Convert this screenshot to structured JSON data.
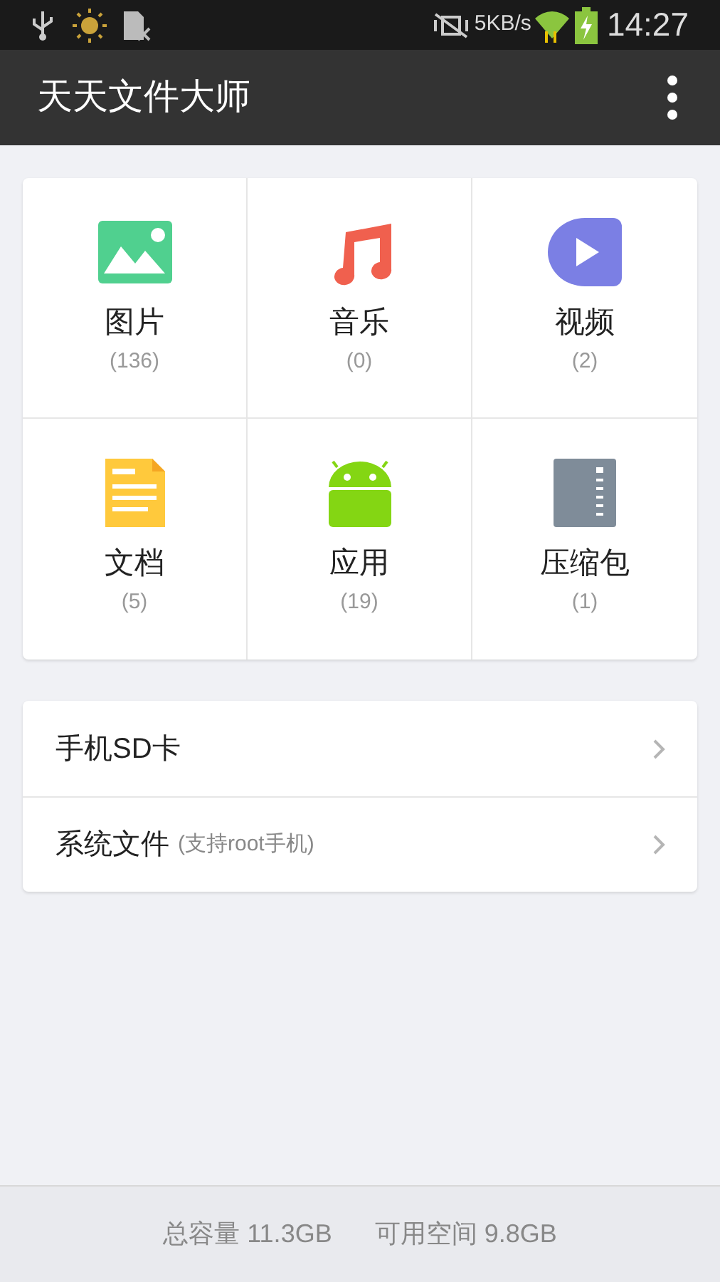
{
  "status_bar": {
    "speed": "5KB/s",
    "time": "14:27"
  },
  "app_bar": {
    "title": "天天文件大师"
  },
  "categories": [
    {
      "kind": "image",
      "label": "图片",
      "count": "(136)"
    },
    {
      "kind": "music",
      "label": "音乐",
      "count": "(0)"
    },
    {
      "kind": "video",
      "label": "视频",
      "count": "(2)"
    },
    {
      "kind": "document",
      "label": "文档",
      "count": "(5)"
    },
    {
      "kind": "app",
      "label": "应用",
      "count": "(19)"
    },
    {
      "kind": "archive",
      "label": "压缩包",
      "count": "(1)"
    }
  ],
  "locations": [
    {
      "label": "手机SD卡"
    },
    {
      "label": "系统文件",
      "note": "(支持root手机)"
    }
  ],
  "footer": {
    "total": "总容量 11.3GB",
    "free": "可用空间 9.8GB"
  }
}
